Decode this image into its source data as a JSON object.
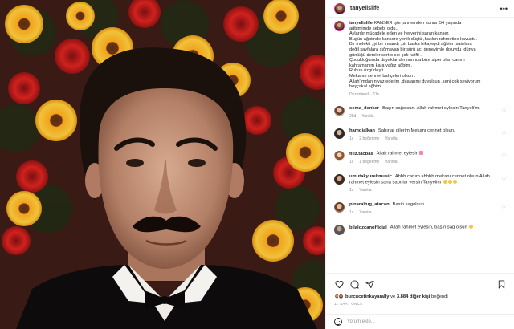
{
  "post": {
    "username": "tanyelislife"
  },
  "caption": {
    "username": "tanyelislife",
    "lines": [
      "KANSER işte ,annemden sonra ,54 yaşında",
      "ağbimimde sebebi oldu,,",
      "Aylardır mücadele eden ve heryerini saran kanser.",
      "Bugün ağbimde kansere yenik düştü ,hakkın rahmetine kavuştu.",
      "Bir melekti ,iyi bir insandı ,bir başka hikayeydi ağbim ,satırlara",
      "değil sayfalara sığmayan bir sürü acı deneyimle doluydu ,dünya",
      "günlüğü dersler sert,o sıe çok naifti .",
      "Çocukluğumda dayaklar deryasında bize siper olan canım",
      "kahramanım kara yağız ağbim .",
      "Ruhun özgürleşti",
      "Mekanın cennet bahçeleri olsun .",
      "Allah'ımdan niyaz ederim ,dualarımı duyulsun ,seni çok seviyorum",
      "hoşçakal ağbim ."
    ],
    "meta": "Düzenlendi · 11s"
  },
  "comments": [
    {
      "username": "sema_denker",
      "text": "Başın sağolsun. Allah rahmet eylesin Tanyeli'm.",
      "time": "28d",
      "likes": "",
      "reply": "Yanıtla"
    },
    {
      "username": "hamdialkan",
      "text": "Sabırlar dilerim.Mekanı cennet olsun.",
      "time": "1s",
      "likes": "2 beğenme",
      "reply": "Yanıtla"
    },
    {
      "username": "filiz.tacbas",
      "text": "Allah rahmet eylesin",
      "time": "1s",
      "likes": "1 beğenme",
      "reply": "Yanıtla"
    },
    {
      "username": "umutakyurekmusic",
      "text": "Ahhh canım ahhhh mekanı cennet olsun Allah rahmet eylesin sana sabırlar versin Tanyelim",
      "time": "1s",
      "likes": "",
      "reply": "Yanıtla"
    },
    {
      "username": "pinaraltug_atacan",
      "text": "Basin sagolsun",
      "time": "1s",
      "likes": "",
      "reply": "Yanıtla"
    },
    {
      "username": "bilalozcanofficial",
      "text": "Allah rahmet eylesin, başın sağ olsun",
      "time": "",
      "likes": "",
      "reply": ""
    }
  ],
  "likes": {
    "user": "burcucetinkayarally",
    "connector": "ve",
    "others": "3.884 diğer kişi",
    "suffix": "beğendi"
  },
  "timestamp": "11 SAAT ÖNCE",
  "add_comment": {
    "placeholder": "Yorum ekle..."
  },
  "icons": {
    "more": "more-horizontal-icon",
    "heart": "heart-icon",
    "comment": "comment-icon",
    "share": "share-icon",
    "save": "bookmark-icon",
    "emoji": "smiley-icon"
  },
  "colors": {
    "accent_ring": "#d6249f",
    "muted_text": "#8e8e8e",
    "primary_text": "#262626"
  }
}
